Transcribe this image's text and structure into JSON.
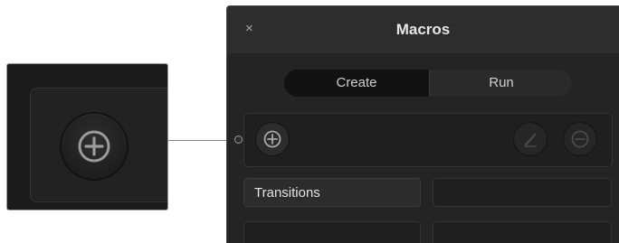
{
  "panel": {
    "title": "Macros",
    "close_glyph": "×"
  },
  "tabs": [
    {
      "label": "Create",
      "selected": true
    },
    {
      "label": "Run",
      "selected": false
    }
  ],
  "toolbar": {
    "add_icon": "plus-circle-icon",
    "edit_icon": "pencil-icon",
    "remove_icon": "minus-circle-icon"
  },
  "macro_slots": [
    {
      "label": "Transitions"
    },
    {
      "label": ""
    },
    {
      "label": ""
    },
    {
      "label": ""
    }
  ],
  "callout": {
    "icon": "plus-circle-icon"
  },
  "colors": {
    "panel_bg": "#242424",
    "titlebar_bg": "#2d2d2d",
    "selected_tab_bg": "#121212"
  }
}
